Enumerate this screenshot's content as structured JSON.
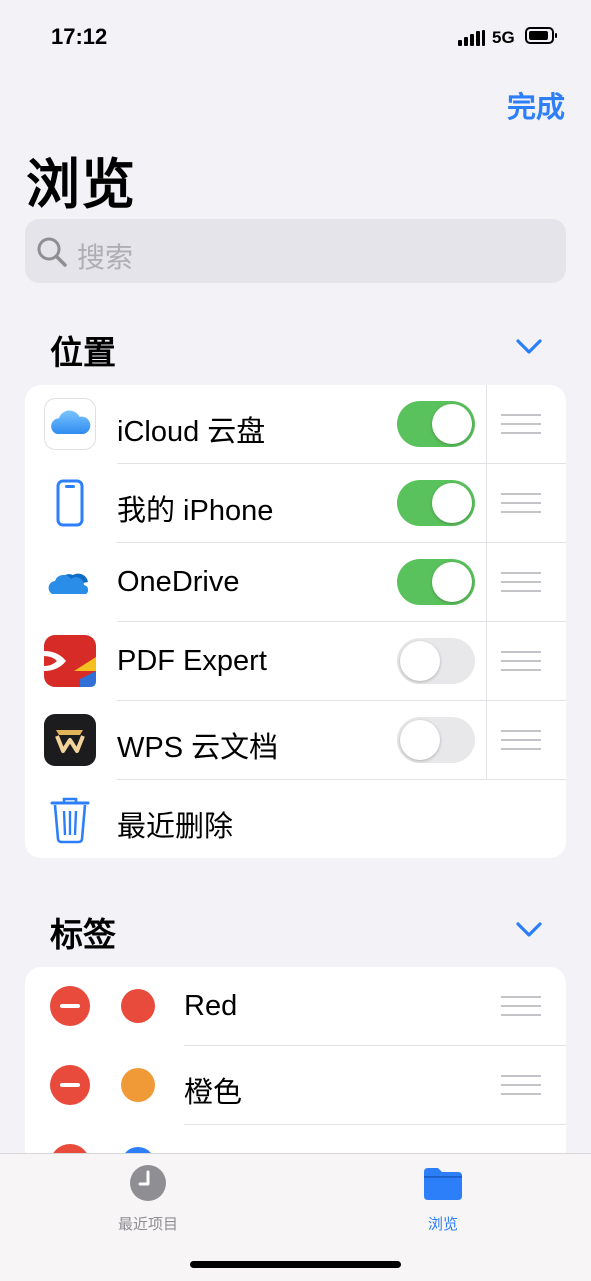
{
  "status": {
    "time": "17:12",
    "network": "5G"
  },
  "nav": {
    "done_label": "完成",
    "title": "浏览"
  },
  "search": {
    "placeholder": "搜索"
  },
  "locations": {
    "title": "位置",
    "items": [
      {
        "label": "iCloud 云盘",
        "icon": "icloud-icon",
        "enabled": true
      },
      {
        "label": "我的 iPhone",
        "icon": "iphone-icon",
        "enabled": true
      },
      {
        "label": "OneDrive",
        "icon": "onedrive-icon",
        "enabled": true
      },
      {
        "label": "PDF Expert",
        "icon": "pdf-expert-icon",
        "enabled": false
      },
      {
        "label": "WPS 云文档",
        "icon": "wps-icon",
        "enabled": false
      }
    ],
    "trash": {
      "label": "最近删除",
      "icon": "trash-icon"
    }
  },
  "tags": {
    "title": "标签",
    "items": [
      {
        "label": "Red",
        "color": "#e84a3c"
      },
      {
        "label": "橙色",
        "color": "#f09a37"
      }
    ],
    "partial_color": "#2d7ff9"
  },
  "tabbar": {
    "recents": {
      "label": "最近项目",
      "icon": "clock-icon",
      "color": "#8e8e93"
    },
    "browse": {
      "label": "浏览",
      "icon": "folder-icon",
      "color": "#2d7ff9"
    }
  },
  "colors": {
    "accent": "#2d7ff9",
    "toggle_on": "#5ac25c",
    "delete": "#e84a3c"
  }
}
